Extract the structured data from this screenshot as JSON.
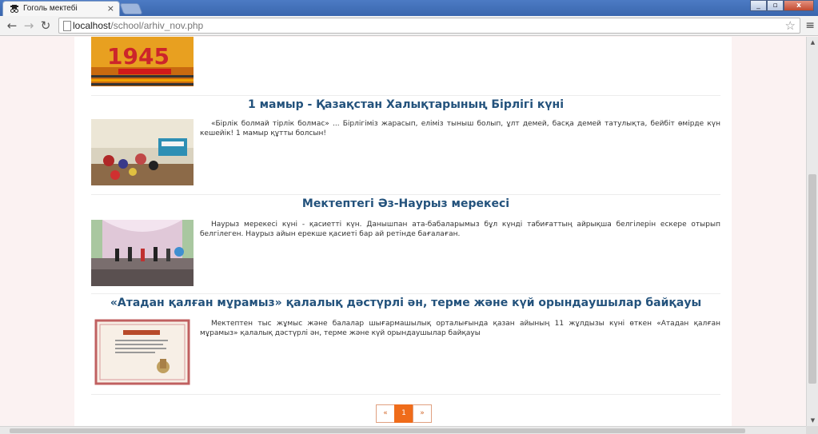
{
  "browser": {
    "tab_title": "Гоголь мектебі",
    "tab_close": "×",
    "url_host": "localhost",
    "url_path": "/school/arhiv_nov.php",
    "back_icon": "←",
    "forward_icon": "→",
    "reload_icon": "↻",
    "star_icon": "☆",
    "menu_icon": "≡",
    "minimize": "_",
    "maximize": "▫",
    "close": "x"
  },
  "colors": {
    "title_link": "#23527c",
    "accent": "#ef6c1a",
    "page_bg": "#fbf2f2"
  },
  "news": [
    {
      "title": "",
      "text": "",
      "image": "victory-day-may-9-banner",
      "partial": true
    },
    {
      "title": "1 мамыр - Қазақстан Халықтарының Бірлігі күні",
      "text": "«Бірлік болмай тірлік болмас» ... Бірлігіміз жарасып, еліміз тыныш болып, ұлт демей, басқа демей татулықта, бейбіт өмірде күн кешейік! 1 мамыр құтты болсын!",
      "image": "classroom-celebration-photo"
    },
    {
      "title": "Мектептегі Әз-Наурыз мерекесі",
      "text": "Наурыз мерекесі күні - қасиетті күн. Данышпан ата-бабаларымыз бұл күнді табиғаттың айрықша белгілерін ескере отырып белгілеген. Наурыз айын ерекше қасиеті бар ай ретінде бағалаған.",
      "image": "nauryz-stage-photo"
    },
    {
      "title": "«Атадан қалған мұрамыз» қалалық дәстүрлі ән, терме және күй орындаушылар байқауы",
      "text": "Мектептен тыс жұмыс және балалар шығармашылық орталығында қазан айының 11 жұлдызы күні өткен «Атадан қалған мұрамыз» қалалық дәстүрлі ән, терме және күй орындаушылар байқауы",
      "image": "diploma-certificate-photo"
    }
  ],
  "pagination": {
    "prev": "«",
    "current": "1",
    "next": "»"
  }
}
